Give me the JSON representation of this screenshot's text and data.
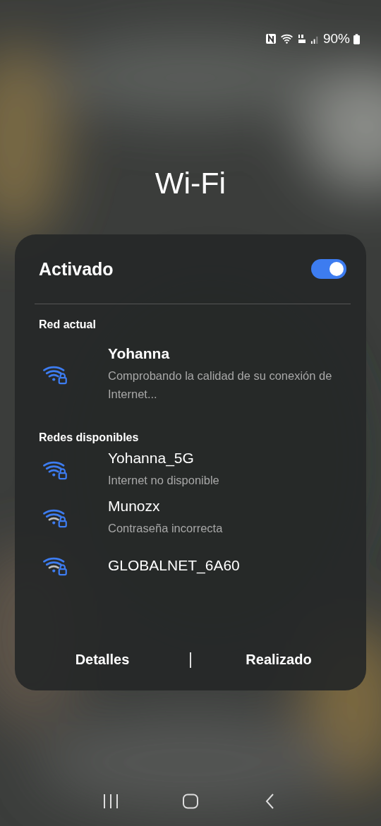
{
  "status_bar": {
    "battery": "90%"
  },
  "title": "Wi-Fi",
  "wifi": {
    "label": "Activado",
    "on": true
  },
  "current": {
    "heading": "Red actual",
    "network": {
      "name": "Yohanna",
      "status": "Comprobando la calidad de su conexión de Internet...",
      "kind": "strong"
    }
  },
  "available": {
    "heading": "Redes disponibles",
    "networks": [
      {
        "name": "Yohanna_5G",
        "status": "Internet no disponible",
        "kind": "strong"
      },
      {
        "name": "Munozx",
        "status": "Contraseña incorrecta",
        "kind": "medium"
      },
      {
        "name": "GLOBALNET_6A60",
        "kind": "medium"
      }
    ]
  },
  "buttons": [
    "Detalles",
    "Realizado"
  ]
}
